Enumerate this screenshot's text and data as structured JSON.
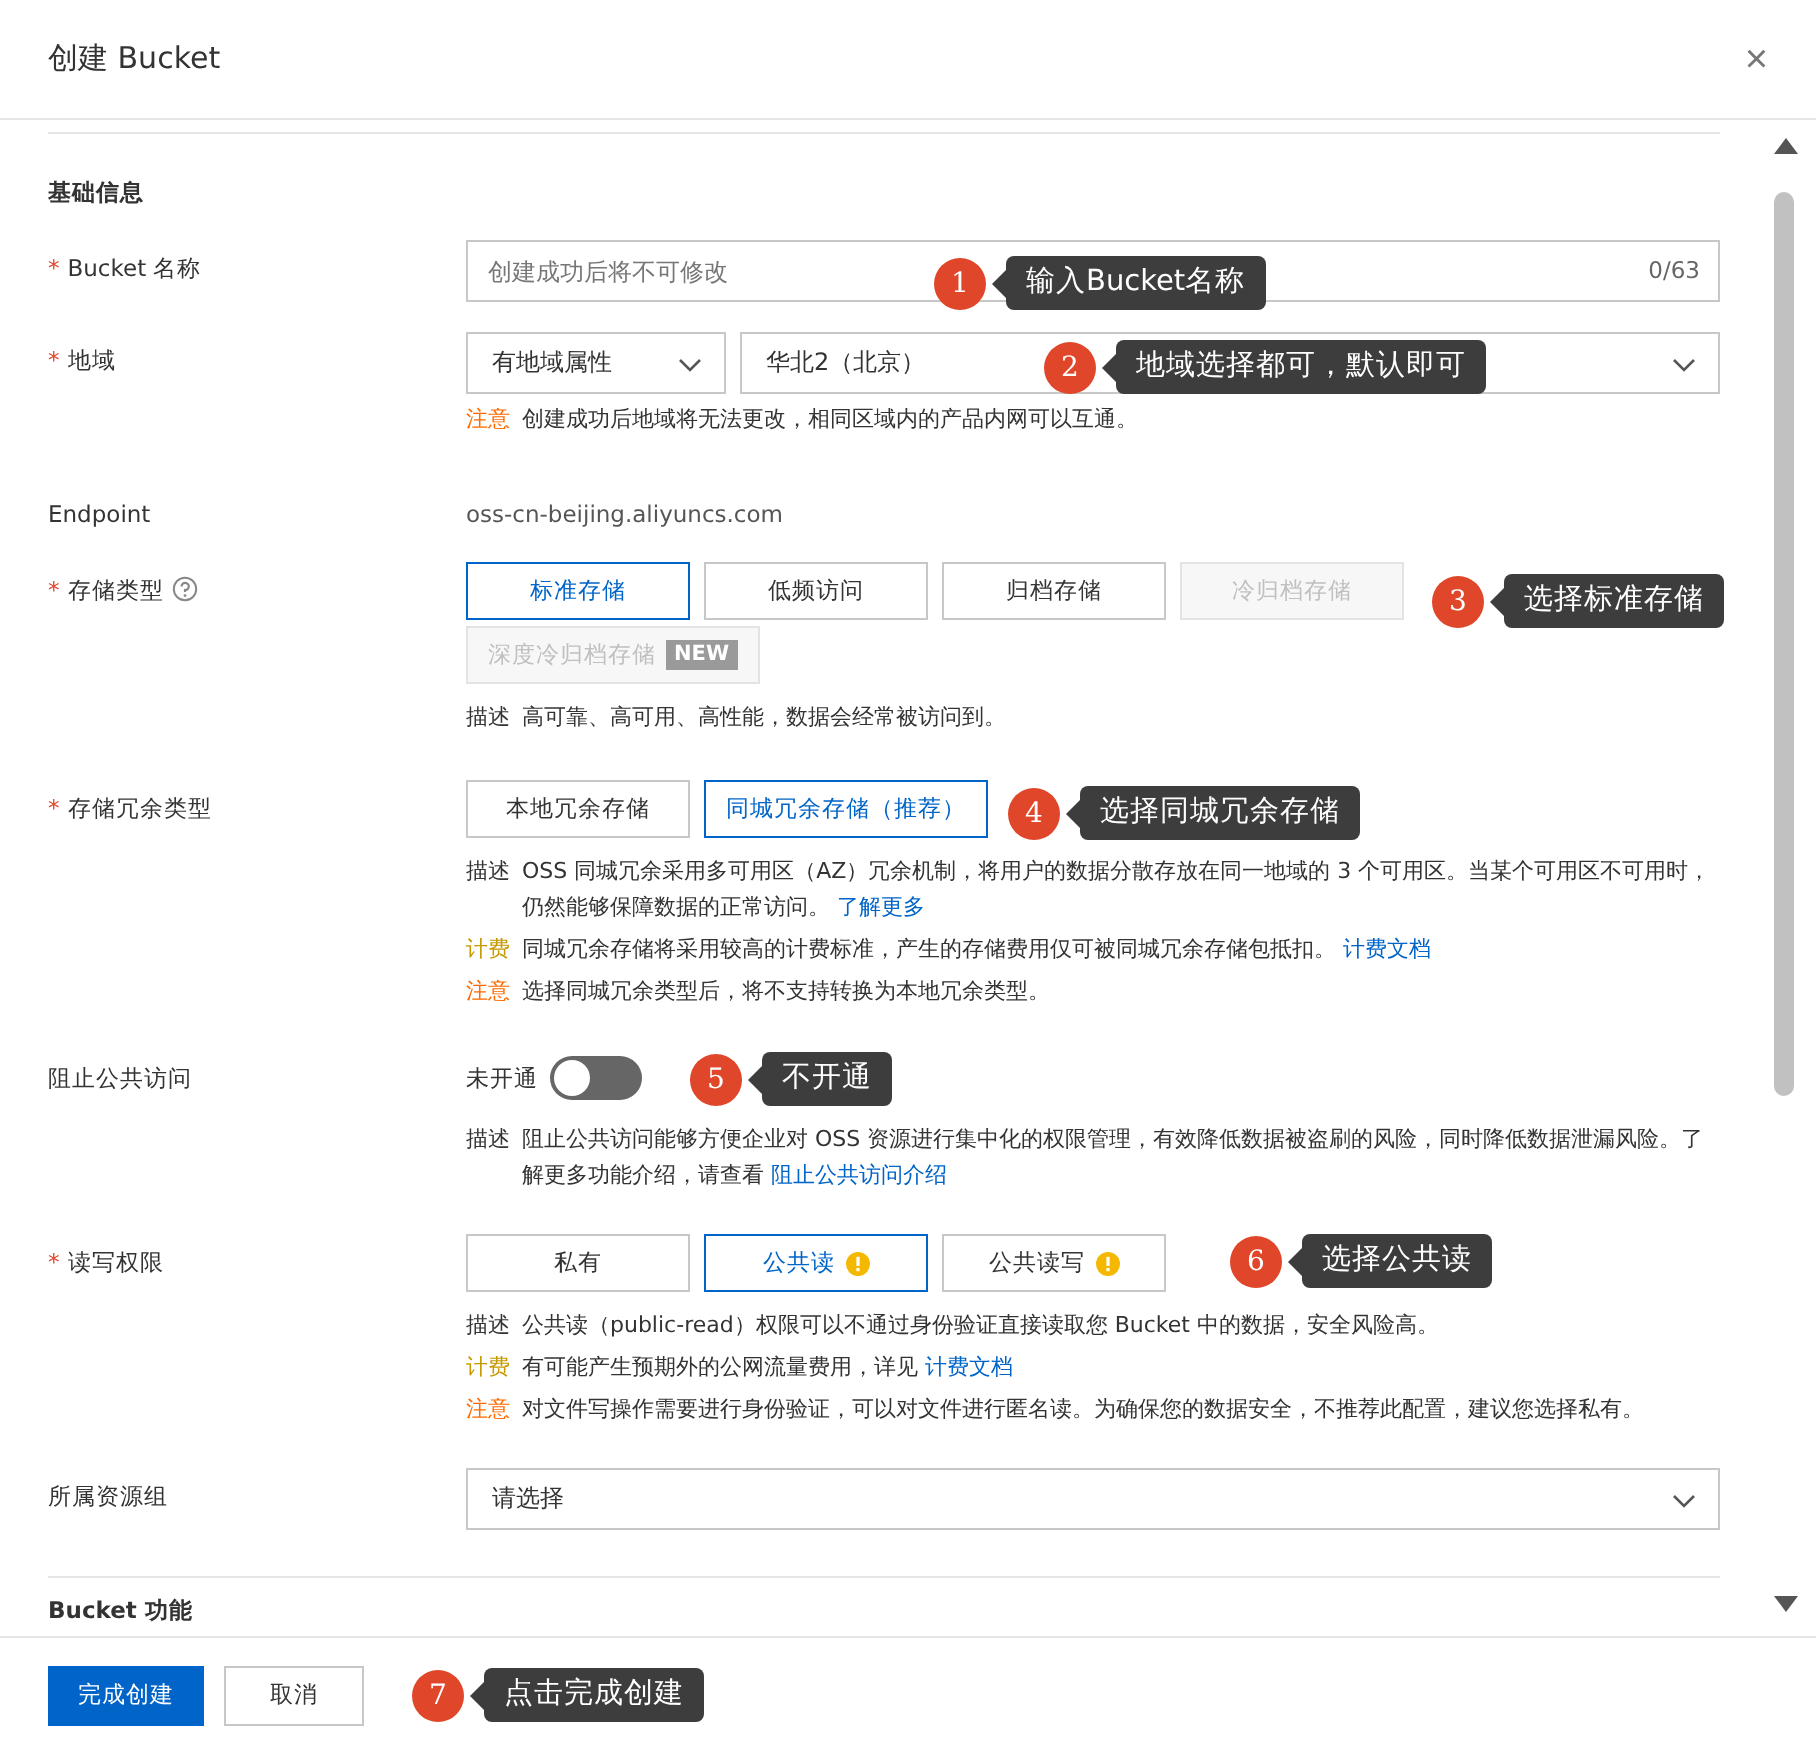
{
  "dialog": {
    "title": "创建 Bucket",
    "close": "×"
  },
  "section": "基础信息",
  "fields": [
    {
      "kind": "input",
      "label": "Bucket 名称",
      "required_mark": "*",
      "placeholder": "创建成功后将不可修改",
      "counter": "0/63"
    },
    {
      "kind": "selects",
      "label": "地域",
      "required_mark": "*",
      "selects": [
        "有地域属性",
        "华北2（北京）"
      ],
      "notes": [
        {
          "color": "#ff6a00",
          "tag": "注意",
          "text": "创建成功后地域将无法更改，相同区域内的产品内网可以互通。"
        }
      ]
    },
    {
      "kind": "text",
      "label": "Endpoint",
      "value": "oss-cn-beijing.aliyuncs.com"
    },
    {
      "kind": "options",
      "label": "存储类型",
      "required_mark": "*",
      "help": true,
      "options": [
        {
          "label": "标准存储",
          "selected": true,
          "disabled": false
        },
        {
          "label": "低频访问",
          "selected": false,
          "disabled": false
        },
        {
          "label": "归档存储",
          "selected": false,
          "disabled": false
        },
        {
          "label": "冷归档存储",
          "selected": false,
          "disabled": true
        },
        {
          "label": "深度冷归档存储",
          "badge": "NEW",
          "selected": false,
          "disabled": true
        }
      ],
      "notes": [
        {
          "color": "#333333",
          "tag": "描述",
          "text": "高可靠、高可用、高性能，数据会经常被访问到。"
        }
      ]
    },
    {
      "kind": "options",
      "label": "存储冗余类型",
      "required_mark": "*",
      "options": [
        {
          "label": "本地冗余存储",
          "selected": false,
          "disabled": false
        },
        {
          "label": "同城冗余存储（推荐）",
          "selected": true,
          "disabled": false
        }
      ],
      "notes": [
        {
          "color": "#333333",
          "tag": "描述",
          "text": "OSS 同城冗余采用多可用区（AZ）冗余机制，将用户的数据分散存放在同一地域的 3 个可用区。当某个可用区不可用时，仍然能够保障数据的正常访问。",
          "link": "了解更多"
        },
        {
          "color": "#c59a00",
          "tag": "计费",
          "text": "同城冗余存储将采用较高的计费标准，产生的存储费用仅可被同城冗余存储包抵扣。",
          "link": "计费文档"
        },
        {
          "color": "#ff6a00",
          "tag": "注意",
          "text": "选择同城冗余类型后，将不支持转换为本地冗余类型。"
        }
      ]
    },
    {
      "kind": "switch",
      "label": "阻止公共访问",
      "switch_label": "未开通",
      "on": false,
      "notes": [
        {
          "color": "#333333",
          "tag": "描述",
          "text": "阻止公共访问能够方便企业对 OSS 资源进行集中化的权限管理，有效降低数据被盗刷的风险，同时降低数据泄漏风险。了解更多功能介绍，请查看",
          "link": "阻止公共访问介绍"
        }
      ]
    },
    {
      "kind": "options",
      "label": "读写权限",
      "required_mark": "*",
      "options": [
        {
          "label": "私有",
          "selected": false,
          "disabled": false,
          "warning": false
        },
        {
          "label": "公共读",
          "selected": true,
          "disabled": false,
          "warning": true
        },
        {
          "label": "公共读写",
          "selected": false,
          "disabled": false,
          "warning": true
        }
      ],
      "notes": [
        {
          "color": "#333333",
          "tag": "描述",
          "text": "公共读（public-read）权限可以不通过身份验证直接读取您 Bucket 中的数据，安全风险高。"
        },
        {
          "color": "#c59a00",
          "tag": "计费",
          "text": "有可能产生预期外的公网流量费用，详见",
          "link": "计费文档"
        },
        {
          "color": "#ff6a00",
          "tag": "注意",
          "text": "对文件写操作需要进行身份验证，可以对文件进行匿名读。为确保您的数据安全，不推荐此配置，建议您选择私有。"
        }
      ]
    },
    {
      "kind": "select",
      "label": "所属资源组",
      "placeholder": "请选择"
    }
  ],
  "next_section": "Bucket 功能",
  "footer": {
    "buttons": [
      {
        "label": "完成创建",
        "primary": true
      },
      {
        "label": "取消",
        "primary": false
      }
    ]
  },
  "annotations": [
    {
      "number": "1",
      "text": "输入Bucket名称"
    },
    {
      "number": "2",
      "text": "地域选择都可，默认即可"
    },
    {
      "number": "3",
      "text": "选择标准存储"
    },
    {
      "number": "4",
      "text": "选择同城冗余存储"
    },
    {
      "number": "5",
      "text": "不开通"
    },
    {
      "number": "6",
      "text": "选择公共读"
    },
    {
      "number": "7",
      "text": "点击完成创建"
    }
  ]
}
